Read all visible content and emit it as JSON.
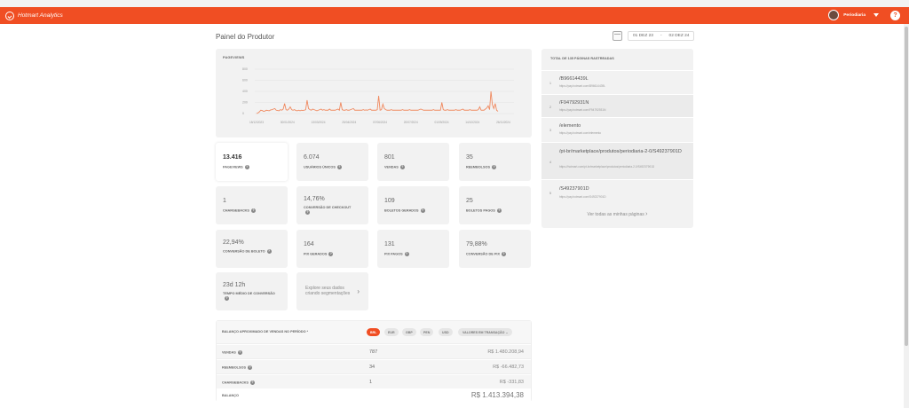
{
  "app": {
    "brand": "Hotmart Analytics",
    "user_name": "Periodiaria",
    "help_label": "?"
  },
  "header": {
    "title": "Painel do Produtor",
    "date_start": "01 DEZ 23",
    "date_sep": "-",
    "date_end": "02 DEZ 24"
  },
  "chart": {
    "title": "PAGEVIEWS"
  },
  "chart_data": {
    "type": "line",
    "title": "PAGEVIEWS",
    "xlabel": "",
    "ylabel": "",
    "y_ticks": [
      "800",
      "600",
      "400",
      "200",
      "0"
    ],
    "ylim": [
      0,
      800
    ],
    "x_tick_labels": [
      "18/12/2023",
      "30/01/2024",
      "13/03/2024",
      "25/04/2024",
      "07/06/2024",
      "20/07/2024",
      "01/09/2024",
      "14/10/2024",
      "26/11/2024"
    ],
    "grid": true,
    "series": [
      {
        "color": "#f0895f",
        "values": [
          0,
          10,
          30,
          60,
          55,
          40,
          45,
          60,
          55,
          50,
          65,
          70,
          80,
          90,
          60,
          55,
          50,
          70,
          60,
          80,
          180,
          70,
          60,
          80,
          120,
          70,
          60,
          70,
          55,
          50,
          60,
          50,
          60,
          55,
          60,
          70,
          240,
          90,
          70,
          60,
          80,
          70,
          60,
          50,
          60,
          70,
          80,
          60,
          70,
          60,
          60,
          60,
          80,
          60,
          60,
          60,
          60,
          70,
          80,
          60,
          200,
          70,
          60,
          60,
          70,
          60,
          60,
          70,
          80,
          90,
          60,
          60,
          60,
          60,
          60,
          60,
          70,
          60,
          65,
          60,
          70,
          80,
          60,
          60,
          60,
          60,
          70,
          320,
          60,
          70,
          170,
          90,
          70,
          60,
          60,
          60,
          70,
          60,
          60,
          60,
          60,
          60,
          60,
          60,
          70,
          60,
          60,
          60,
          60,
          70,
          60,
          60,
          60,
          60,
          60,
          60,
          70,
          80,
          70,
          60,
          60,
          60,
          60,
          60,
          60,
          60,
          70,
          60,
          60,
          60,
          60,
          60,
          200,
          70,
          60,
          60,
          70,
          60,
          60,
          60,
          60,
          60,
          70,
          60,
          60,
          60,
          70,
          80,
          60,
          60,
          60,
          60,
          70,
          60,
          60,
          60,
          60,
          60,
          70,
          120,
          60,
          60,
          60,
          80,
          100,
          140,
          70,
          400,
          160,
          90,
          180,
          60,
          40
        ]
      }
    ]
  },
  "metrics": [
    {
      "value": "13.416",
      "label": "PAGEVIEWS"
    },
    {
      "value": "6.074",
      "label": "USUÁRIOS ÚNICOS"
    },
    {
      "value": "801",
      "label": "VENDAS"
    },
    {
      "value": "35",
      "label": "REEMBOLSOS"
    },
    {
      "value": "1",
      "label": "CHARGEBACKS"
    },
    {
      "value": "14,76%",
      "label": "CONVERSÃO DE CHECKOUT"
    },
    {
      "value": "109",
      "label": "BOLETOS GERADOS"
    },
    {
      "value": "25",
      "label": "BOLETOS PAGOS"
    },
    {
      "value": "22,94%",
      "label": "CONVERSÃO DE BOLETO"
    },
    {
      "value": "164",
      "label": "PIX GERADOS"
    },
    {
      "value": "131",
      "label": "PIX PAGOS"
    },
    {
      "value": "79,88%",
      "label": "CONVERSÃO DE PIX"
    },
    {
      "value": "23d 12h",
      "label": "TEMPO MÉDIO DE CONVERSÃO"
    }
  ],
  "explore": {
    "text": "Explore seus dados criando segmentações",
    "arrow": "›"
  },
  "balance": {
    "title": "BALANÇO APROXIMADO DE VENDAS NO PERÍODO *",
    "currencies": [
      "BRL",
      "EUR",
      "GBP",
      "PEN",
      "USD"
    ],
    "active_currency": "BRL",
    "valores_label": "VALORES EM TRANSAÇÃO ⌄",
    "rows": [
      {
        "label": "VENDAS",
        "count": "787",
        "amount": "R$ 1.480.208,94"
      },
      {
        "label": "REEMBOLSOS",
        "count": "34",
        "amount": "R$ -66.482,73"
      },
      {
        "label": "CHARGEBACKS",
        "count": "1",
        "amount": "R$ -331,83"
      }
    ],
    "total": {
      "label": "BALANÇO",
      "amount": "R$ 1.413.394,38"
    }
  },
  "pages": {
    "title": "TOTAL DE 135 PÁGINAS RASTREADAS",
    "items": [
      {
        "num": "1",
        "title": "/B96614439L",
        "url": "https://pay.hotmart.com/B96614439L"
      },
      {
        "num": "2",
        "title": "/F94792931N",
        "url": "https://pay.hotmart.com/F94792931N"
      },
      {
        "num": "3",
        "title": "/elemento",
        "url": "https://pay.hotmart.com/elemento"
      },
      {
        "num": "4",
        "title": "/pt-br/marketplace/produtos/periodiaria-2-0/S49237901D",
        "url": "https://hotmart.com/pt-br/marketplace/produtos/periodiaria-2-0/S49237901D"
      },
      {
        "num": "5",
        "title": "/S49237901D",
        "url": "https://pay.hotmart.com/S49237901D"
      }
    ],
    "see_all": "Ver todas as minhas páginas",
    "see_all_arrow": "›"
  }
}
